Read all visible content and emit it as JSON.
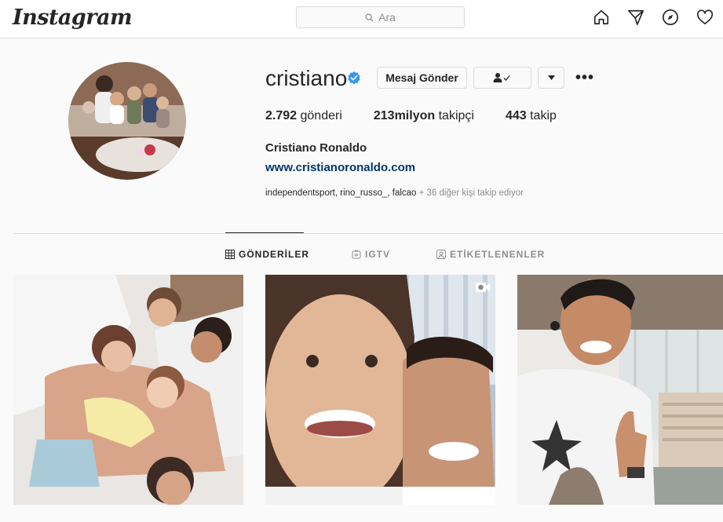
{
  "nav": {
    "logo": "Instagram",
    "search_placeholder": "Ara",
    "icons": [
      "home-icon",
      "direct-icon",
      "explore-icon",
      "activity-icon"
    ]
  },
  "profile": {
    "username": "cristiano",
    "verified": true,
    "message_button": "Mesaj Gönder",
    "stats": {
      "posts_count": "2.792",
      "posts_label": "gönderi",
      "followers_count": "213milyon",
      "followers_label": "takipçi",
      "following_count": "443",
      "following_label": "takip"
    },
    "full_name": "Cristiano Ronaldo",
    "website": "www.cristianoronaldo.com",
    "followed_by_names": "independentsport, rino_russo_, falcao",
    "followed_by_more": "+ 36 diğer kişi takip ediyor"
  },
  "tabs": [
    {
      "label": "GÖNDERİLER",
      "icon": "grid-icon",
      "active": true
    },
    {
      "label": "IGTV",
      "icon": "igtv-icon",
      "active": false
    },
    {
      "label": "ETİKETLENENLER",
      "icon": "tagged-icon",
      "active": false
    }
  ],
  "colors": {
    "link": "#00376b",
    "verified": "#3897f0",
    "border": "#dbdbdb",
    "muted": "#8e8e8e"
  }
}
